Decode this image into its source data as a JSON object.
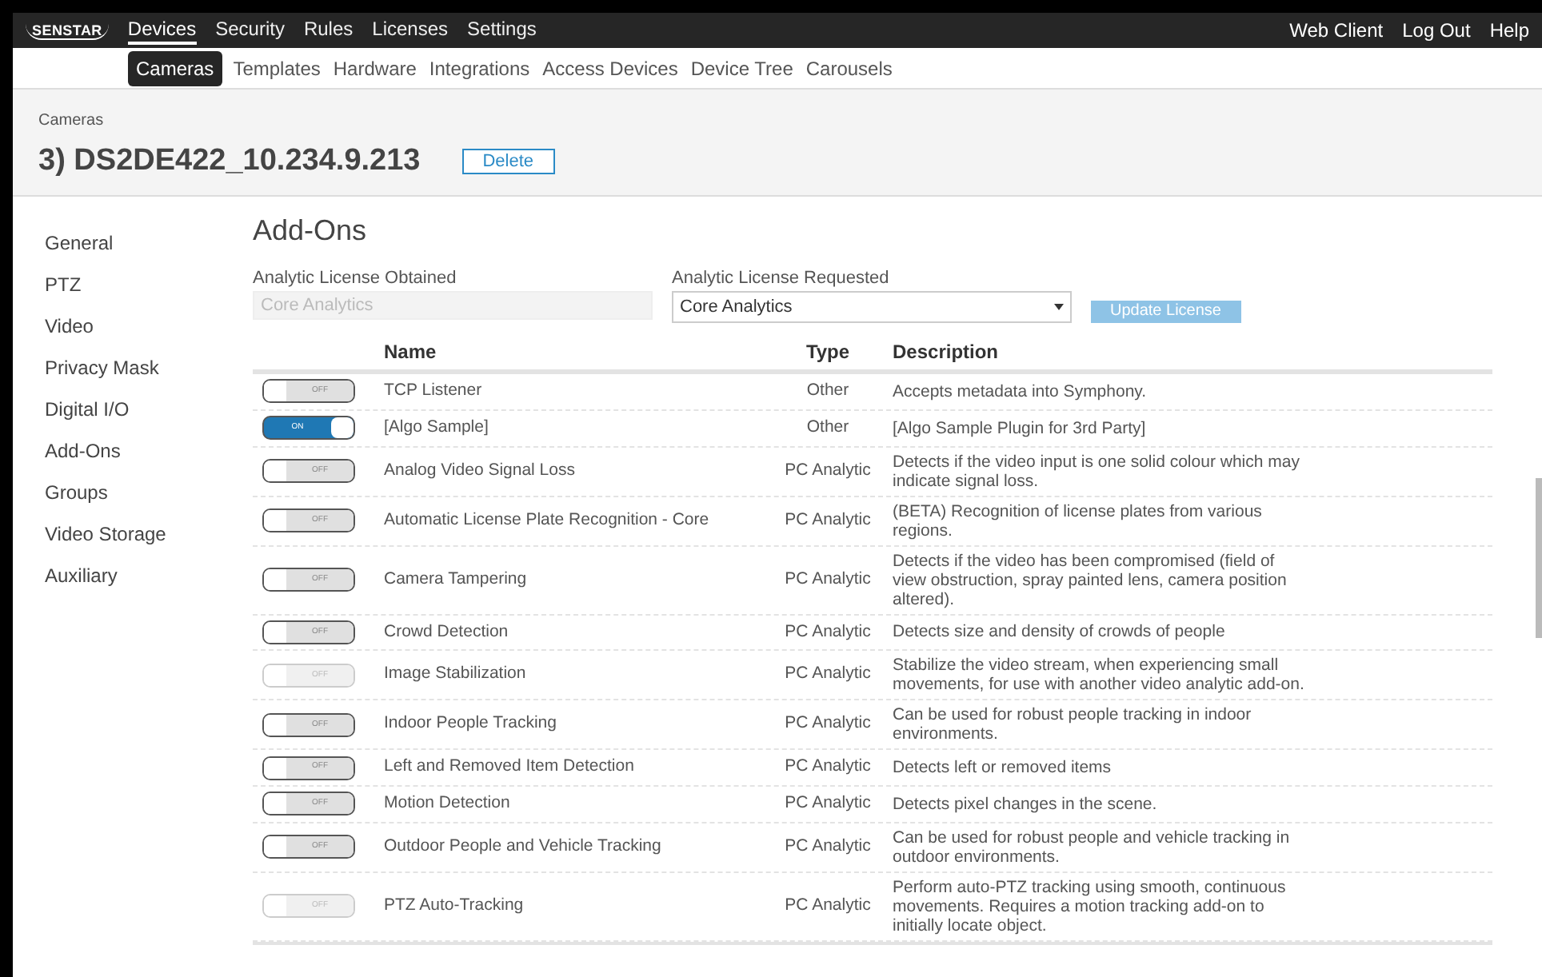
{
  "brand": "SENSTAR",
  "top_nav": [
    {
      "label": "Devices",
      "selected": true
    },
    {
      "label": "Security",
      "selected": false
    },
    {
      "label": "Rules",
      "selected": false
    },
    {
      "label": "Licenses",
      "selected": false
    },
    {
      "label": "Settings",
      "selected": false
    }
  ],
  "top_links": [
    "Web Client",
    "Log Out",
    "Help"
  ],
  "sub_nav": [
    {
      "label": "Cameras",
      "selected": true
    },
    {
      "label": "Templates",
      "selected": false
    },
    {
      "label": "Hardware",
      "selected": false
    },
    {
      "label": "Integrations",
      "selected": false
    },
    {
      "label": "Access Devices",
      "selected": false
    },
    {
      "label": "Device Tree",
      "selected": false
    },
    {
      "label": "Carousels",
      "selected": false
    }
  ],
  "breadcrumb": "Cameras",
  "title": "3) DS2DE422_10.234.9.213",
  "delete_button": "Delete",
  "sidebar": {
    "items": [
      "General",
      "PTZ",
      "Video",
      "Privacy Mask",
      "Digital I/O",
      "Add-Ons",
      "Groups",
      "Video Storage",
      "Auxiliary"
    ]
  },
  "section_title": "Add-Ons",
  "license_obtained": {
    "label": "Analytic License Obtained",
    "value": "Core Analytics"
  },
  "license_requested": {
    "label": "Analytic License Requested",
    "value": "Core Analytics"
  },
  "update_button": "Update License",
  "table": {
    "columns": [
      "Name",
      "Type",
      "Description"
    ],
    "rows": [
      {
        "on": false,
        "disabled": false,
        "toggle_text": "OFF",
        "name": "TCP Listener",
        "type": "Other",
        "description": "Accepts metadata into Symphony."
      },
      {
        "on": true,
        "disabled": false,
        "toggle_text": "ON",
        "name": "[Algo Sample]",
        "type": "Other",
        "description": "[Algo Sample Plugin for 3rd Party]"
      },
      {
        "on": false,
        "disabled": false,
        "toggle_text": "OFF",
        "name": "Analog Video Signal Loss",
        "type": "PC Analytic",
        "description": "Detects if the video input is one solid colour which may indicate signal loss."
      },
      {
        "on": false,
        "disabled": false,
        "toggle_text": "OFF",
        "name": "Automatic License Plate Recognition - Core",
        "type": "PC Analytic",
        "description": "(BETA) Recognition of license plates from various regions."
      },
      {
        "on": false,
        "disabled": false,
        "toggle_text": "OFF",
        "name": "Camera Tampering",
        "type": "PC Analytic",
        "description": "Detects if the video has been compromised (field of view obstruction, spray painted lens, camera position altered)."
      },
      {
        "on": false,
        "disabled": false,
        "toggle_text": "OFF",
        "name": "Crowd Detection",
        "type": "PC Analytic",
        "description": "Detects size and density of crowds of people"
      },
      {
        "on": false,
        "disabled": true,
        "toggle_text": "OFF",
        "name": "Image Stabilization",
        "type": "PC Analytic",
        "description": "Stabilize the video stream, when experiencing small movements, for use with another video analytic add-on."
      },
      {
        "on": false,
        "disabled": false,
        "toggle_text": "OFF",
        "name": "Indoor People Tracking",
        "type": "PC Analytic",
        "description": "Can be used for robust people tracking in indoor environments."
      },
      {
        "on": false,
        "disabled": false,
        "toggle_text": "OFF",
        "name": "Left and Removed Item Detection",
        "type": "PC Analytic",
        "description": "Detects left or removed items"
      },
      {
        "on": false,
        "disabled": false,
        "toggle_text": "OFF",
        "name": "Motion Detection",
        "type": "PC Analytic",
        "description": "Detects pixel changes in the scene."
      },
      {
        "on": false,
        "disabled": false,
        "toggle_text": "OFF",
        "name": "Outdoor People and Vehicle Tracking",
        "type": "PC Analytic",
        "description": "Can be used for robust people and vehicle tracking in outdoor environments."
      },
      {
        "on": false,
        "disabled": true,
        "toggle_text": "OFF",
        "name": "PTZ Auto-Tracking",
        "type": "PC Analytic",
        "description": "Perform auto-PTZ tracking using smooth, continuous movements. Requires a motion tracking add-on to initially locate object."
      }
    ]
  }
}
